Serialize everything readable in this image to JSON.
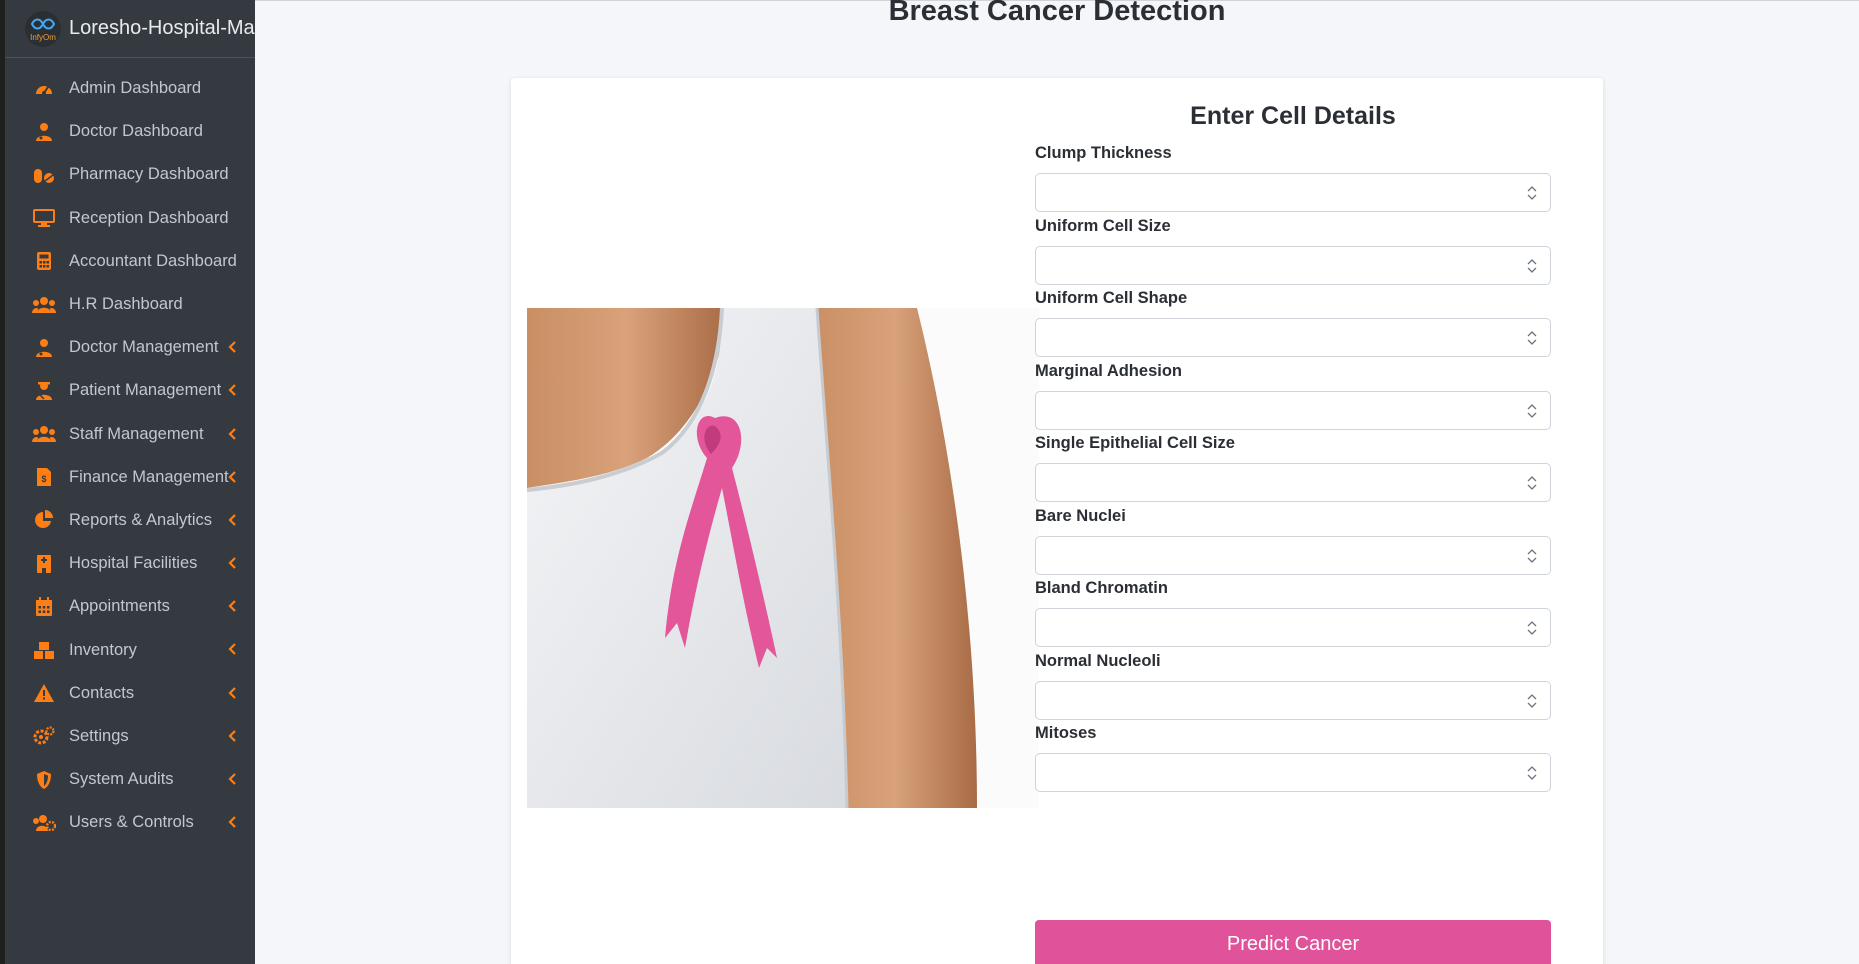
{
  "app": {
    "brand": "Loresho-Hospital-Management",
    "logo_text": "InfyOm",
    "accent_color": "#fd7e14"
  },
  "sidebar": {
    "items": [
      {
        "label": "Admin Dashboard",
        "icon": "tachometer-icon",
        "has_submenu": false
      },
      {
        "label": "Doctor Dashboard",
        "icon": "user-doctor-icon",
        "has_submenu": false
      },
      {
        "label": "Pharmacy Dashboard",
        "icon": "pills-icon",
        "has_submenu": false
      },
      {
        "label": "Reception Dashboard",
        "icon": "desktop-icon",
        "has_submenu": false
      },
      {
        "label": "Accountant Dashboard",
        "icon": "calculator-icon",
        "has_submenu": false
      },
      {
        "label": "H.R Dashboard",
        "icon": "users-icon",
        "has_submenu": false
      },
      {
        "label": "Doctor Management",
        "icon": "user-doctor-icon",
        "has_submenu": true
      },
      {
        "label": "Patient Management",
        "icon": "user-injured-icon",
        "has_submenu": true
      },
      {
        "label": "Staff Management",
        "icon": "users-icon",
        "has_submenu": true
      },
      {
        "label": "Finance Management",
        "icon": "invoice-dollar-icon",
        "has_submenu": true
      },
      {
        "label": "Reports & Analytics",
        "icon": "chart-pie-icon",
        "has_submenu": true
      },
      {
        "label": "Hospital Facilities",
        "icon": "hospital-icon",
        "has_submenu": true
      },
      {
        "label": "Appointments",
        "icon": "calendar-icon",
        "has_submenu": true
      },
      {
        "label": "Inventory",
        "icon": "boxes-icon",
        "has_submenu": true
      },
      {
        "label": "Contacts",
        "icon": "warning-triangle-icon",
        "has_submenu": true
      },
      {
        "label": "Settings",
        "icon": "gears-icon",
        "has_submenu": true
      },
      {
        "label": "System Audits",
        "icon": "shield-icon",
        "has_submenu": true
      },
      {
        "label": "Users & Controls",
        "icon": "users-cog-icon",
        "has_submenu": true
      }
    ]
  },
  "page": {
    "title": "Breast Cancer Detection",
    "form_heading": "Enter Cell Details",
    "image_icon": "pink-ribbon-photo",
    "submit_label": "Predict Cancer",
    "submit_color": "#e0539a",
    "fields": [
      {
        "label": "Clump Thickness",
        "value": ""
      },
      {
        "label": "Uniform Cell Size",
        "value": ""
      },
      {
        "label": "Uniform Cell Shape",
        "value": ""
      },
      {
        "label": "Marginal Adhesion",
        "value": ""
      },
      {
        "label": "Single Epithelial Cell Size",
        "value": ""
      },
      {
        "label": "Bare Nuclei",
        "value": ""
      },
      {
        "label": "Bland Chromatin",
        "value": ""
      },
      {
        "label": "Normal Nucleoli",
        "value": ""
      },
      {
        "label": "Mitoses",
        "value": ""
      }
    ]
  }
}
